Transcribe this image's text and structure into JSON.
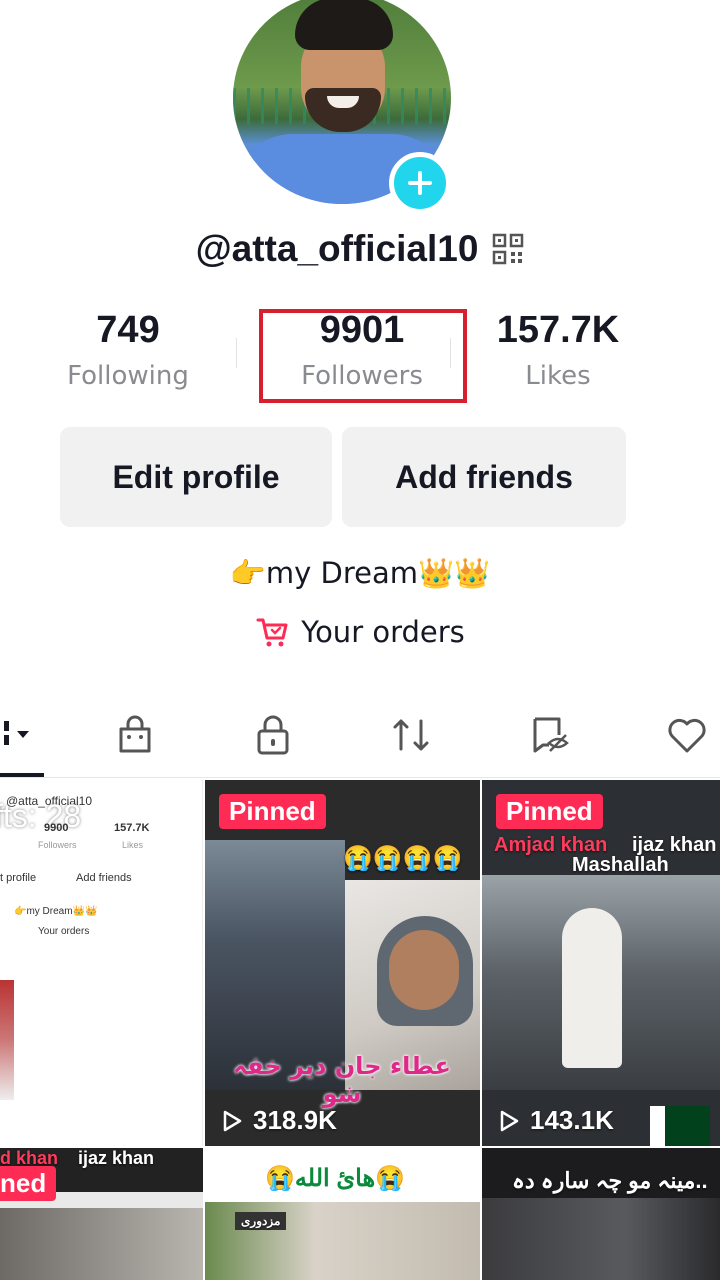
{
  "profile": {
    "username": "@atta_official10",
    "bio": "👉my Dream👑👑",
    "orders_label": "Your orders"
  },
  "stats": {
    "following": {
      "value": "749",
      "label": "Following"
    },
    "followers": {
      "value": "9901",
      "label": "Followers"
    },
    "likes": {
      "value": "157.7K",
      "label": "Likes"
    }
  },
  "buttons": {
    "edit_profile": "Edit profile",
    "add_friends": "Add friends"
  },
  "tabs": [
    {
      "icon": "grid-icon",
      "active": true
    },
    {
      "icon": "shopping-bag-icon"
    },
    {
      "icon": "lock-icon"
    },
    {
      "icon": "repost-icon"
    },
    {
      "icon": "hidden-tag-icon"
    },
    {
      "icon": "heart-icon"
    }
  ],
  "videos": [
    {
      "mini_username": "@atta_official10",
      "gifts_text": "fts: 28",
      "mini_followers": "9900",
      "mini_likes": "157.7K",
      "mini_followers_label": "Followers",
      "mini_likes_label": "Likes",
      "mini_edit": "t profile",
      "mini_add": "Add friends",
      "mini_bio": "👉my Dream👑👑",
      "mini_orders": "Your orders"
    },
    {
      "pinned": "Pinned",
      "views": "318.9K",
      "emoji_row": "😭😭😭😭",
      "caption": "عطاء جان دیر خفہ شو"
    },
    {
      "pinned": "Pinned",
      "views": "143.1K",
      "caption_left": "Amjad khan",
      "caption_right": "ijaz khan",
      "caption_sub": "Mashallah"
    },
    {
      "pinned": "ned",
      "caption_left": "d khan",
      "caption_right": "ijaz khan"
    },
    {
      "caption": "😭هائ الله😭",
      "sub": "مزدوری"
    },
    {
      "caption": "مینہ مو چہ سارہ دہ.."
    }
  ],
  "colors": {
    "accent_pink": "#fe2c55",
    "badge_cyan": "#20d5ec",
    "highlight_red": "#d6202f",
    "button_bg": "#f1f1f2",
    "text_primary": "#161823",
    "text_secondary": "#8a8b91"
  }
}
